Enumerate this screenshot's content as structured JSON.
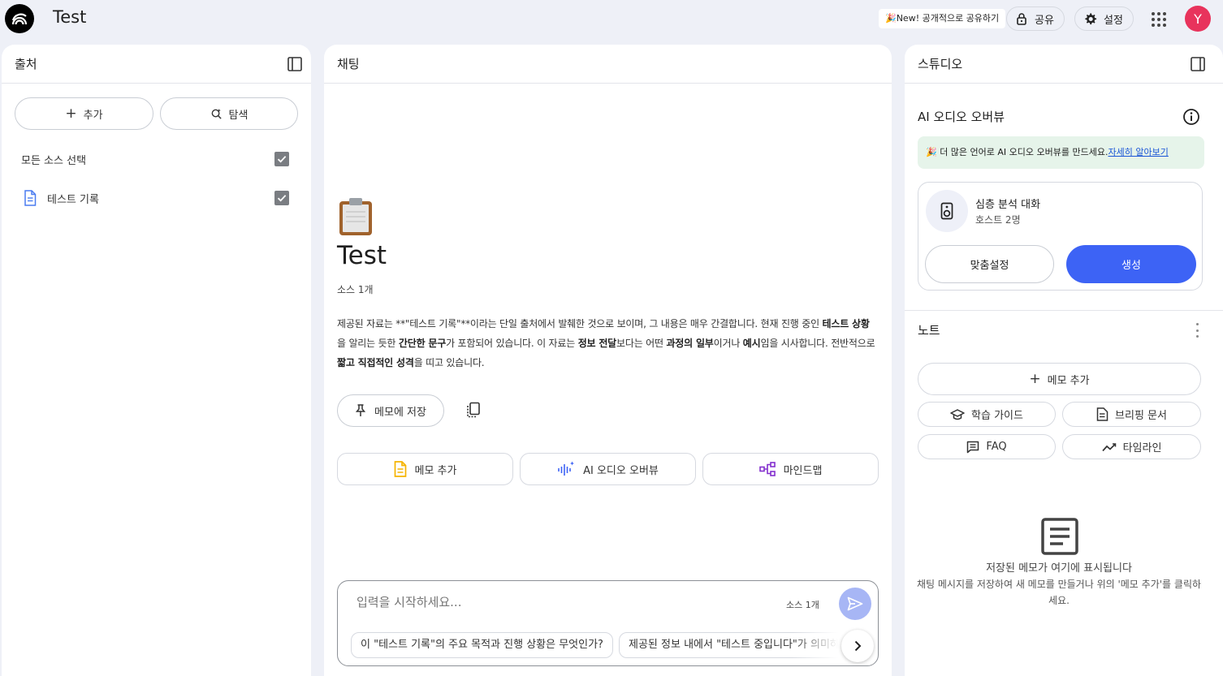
{
  "header": {
    "title": "Test",
    "promo": "🎉New! 공개적으로 공유하기",
    "share_label": "공유",
    "settings_label": "설정",
    "avatar_initial": "Y"
  },
  "sources": {
    "title": "출처",
    "add_label": "추가",
    "discover_label": "탐색",
    "select_all_label": "모든 소스 선택",
    "select_all_checked": true,
    "items": [
      {
        "label": "테스트 기록",
        "checked": true,
        "icon": "document-icon"
      }
    ]
  },
  "chat": {
    "title": "채팅",
    "notebook_emoji": "📋",
    "notebook_title": "Test",
    "source_count": "소스 1개",
    "summary": {
      "s1": "제공된 자료는 **\"테스트 기록\"**이라는 단일 출처에서 발췌한 것으로 보이며, 그 내용은 매우 간결합니다. 현재 진행 중인 ",
      "b1": "테스트 상황",
      "s2": "을 알리는 듯한 ",
      "b2": "간단한 문구",
      "s3": "가 포함되어 있습니다. 이 자료는 ",
      "b3": "정보 전달",
      "s4": "보다는 어떤 ",
      "b4": "과정의 일부",
      "s5": "이거나 ",
      "b5": "예시",
      "s6": "임을 시사합니다. 전반적으로 ",
      "b6": "짧고 직접적인 성격",
      "s7": "을 띠고 있습니다."
    },
    "save_to_note_label": "메모에 저장",
    "actions": [
      {
        "label": "메모 추가",
        "icon": "note-icon",
        "color": "#f5b400"
      },
      {
        "label": "AI 오디오 오버뷰",
        "icon": "audio-wave-icon",
        "color": "#3d63f5"
      },
      {
        "label": "마인드맵",
        "icon": "mindmap-icon",
        "color": "#8430ce"
      }
    ],
    "composer": {
      "placeholder": "입력을 시작하세요...",
      "source_count": "소스 1개"
    },
    "suggestions": [
      "이 \"테스트 기록\"의 주요 목적과 진행 상황은 무엇인가?",
      "제공된 정보 내에서 \"테스트 중입니다\"가 의미하는"
    ]
  },
  "studio": {
    "title": "스튜디오",
    "audio_section_title": "AI 오디오 오버뷰",
    "promo_text": "🎉 더 많은 언어로 AI 오디오 오버뷰를 만드세요.",
    "promo_link": "자세히 알아보기",
    "deep_dive_title": "심층 분석 대화",
    "deep_dive_sub": "호스트 2명",
    "customize_label": "맞춤설정",
    "generate_label": "생성",
    "notes_title": "노트",
    "add_note_label": "메모 추가",
    "tools": [
      {
        "label": "학습 가이드",
        "icon": "graduation-cap-icon"
      },
      {
        "label": "브리핑 문서",
        "icon": "briefing-doc-icon"
      },
      {
        "label": "FAQ",
        "icon": "faq-icon"
      },
      {
        "label": "타임라인",
        "icon": "timeline-icon"
      }
    ],
    "empty_title": "저장된 메모가 여기에 표시됩니다",
    "empty_desc": "채팅 메시지를 저장하여 새 메모를 만들거나 위의 '메모 추가'를 클릭하세요."
  },
  "colors": {
    "accent": "#3d63f5",
    "avatar": "#e8335c",
    "background": "#eef0f7"
  }
}
